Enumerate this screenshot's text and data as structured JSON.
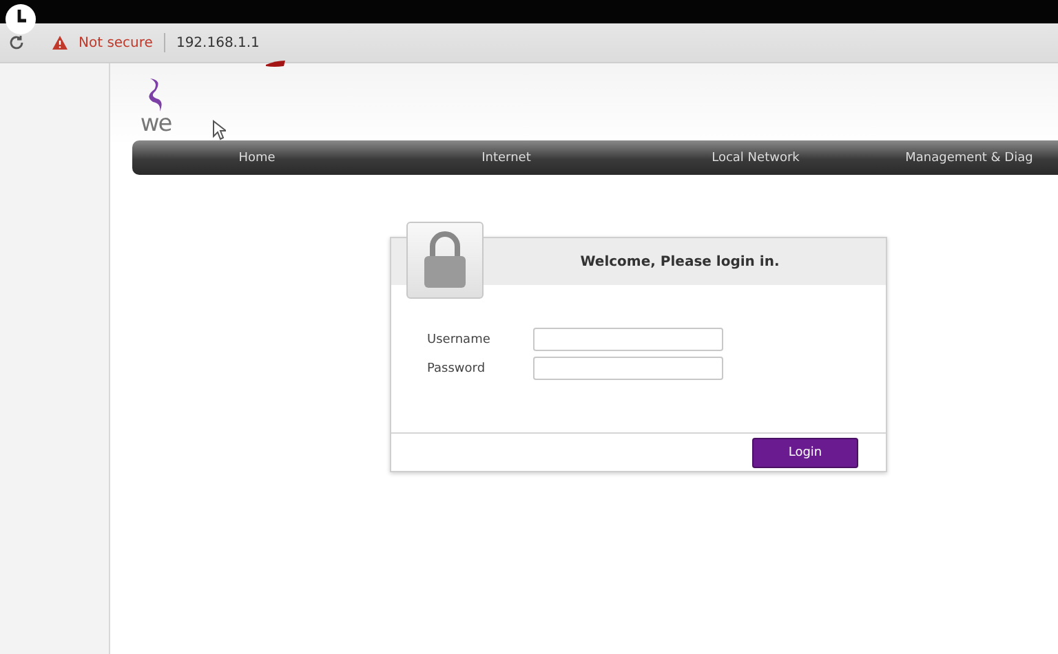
{
  "browser": {
    "security": "Not secure",
    "url": "192.168.1.1"
  },
  "logo": {
    "text": "we"
  },
  "nav": [
    {
      "label": "Home"
    },
    {
      "label": "Internet"
    },
    {
      "label": "Local Network"
    },
    {
      "label": "Management & Diag"
    }
  ],
  "login": {
    "title": "Welcome, Please login in.",
    "fields": [
      {
        "label": "Username"
      },
      {
        "label": "Password"
      }
    ],
    "button": "Login"
  }
}
